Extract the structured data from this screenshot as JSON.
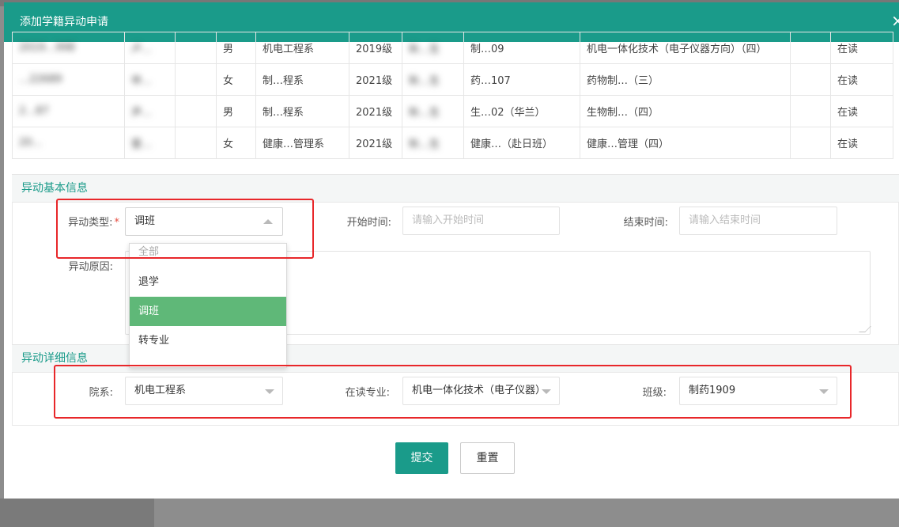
{
  "modal": {
    "title": "添加学籍异动申请",
    "close_icon": "close-icon"
  },
  "table": {
    "rows": [
      [
        "2019…998",
        "卢…",
        "",
        "男",
        "机电工程系",
        "2019级",
        "秋…生",
        "制…09",
        "机电一体化技术（电子仪器方向）（四）",
        "",
        "在读"
      ],
      [
        "…22689",
        "申…",
        "",
        "女",
        "制…程系",
        "2021级",
        "秋…生",
        "药…107",
        "药物制…（三）",
        "",
        "在读"
      ],
      [
        "2…87",
        "尹…",
        "",
        "男",
        "制…程系",
        "2021级",
        "秋…生",
        "生…02（华兰）",
        "生物制…（四）",
        "",
        "在读"
      ],
      [
        "20…",
        "雷…",
        "",
        "女",
        "健康…管理系",
        "2021级",
        "秋…生",
        "健康…（赴日班）",
        "健康…管理（四）",
        "",
        "在读"
      ]
    ]
  },
  "basic_section": {
    "title": "异动基本信息",
    "type_label": "异动类型:",
    "type_required_mark": "*",
    "type_value": "调班",
    "start_label": "开始时间:",
    "start_placeholder": "请输入开始时间",
    "end_label": "结束时间:",
    "end_placeholder": "请输入结束时间",
    "reason_label": "异动原因:"
  },
  "dropdown": {
    "options": [
      "全部",
      "退学",
      "调班",
      "转专业"
    ],
    "selected": "调班"
  },
  "detail_section": {
    "title": "异动详细信息",
    "dept_label": "院系:",
    "dept_value": "机电工程系",
    "major_label": "在读专业:",
    "major_value": "机电一体化技术（电子仪器）",
    "class_label": "班级:",
    "class_value": "制药1909"
  },
  "actions": {
    "submit": "提交",
    "reset": "重置"
  },
  "colors": {
    "header": "#1a9b8a",
    "selected_option": "#5fb878",
    "highlight_border": "#e8272a"
  }
}
